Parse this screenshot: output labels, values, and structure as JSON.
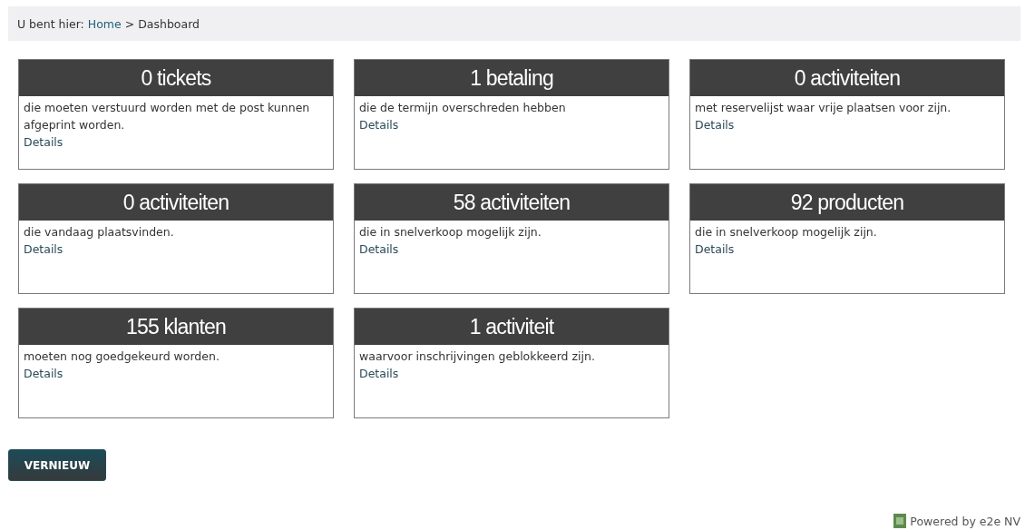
{
  "breadcrumb": {
    "prefix": "U bent hier:",
    "items": [
      {
        "label": "Home",
        "link": true
      },
      {
        "label": "Dashboard",
        "link": false
      }
    ],
    "separator": ">"
  },
  "cards": [
    {
      "title": "0 tickets",
      "text": "die moeten verstuurd worden met de post kunnen afgeprint worden.",
      "link": "Details"
    },
    {
      "title": "1 betaling",
      "text": "die de termijn overschreden hebben",
      "link": "Details"
    },
    {
      "title": "0 activiteiten",
      "text": "met reservelijst waar vrije plaatsen voor zijn.",
      "link": "Details"
    },
    {
      "title": "0 activiteiten",
      "text": "die vandaag plaatsvinden.",
      "link": "Details"
    },
    {
      "title": "58 activiteiten",
      "text": "die in snelverkoop mogelijk zijn.",
      "link": "Details"
    },
    {
      "title": "92 producten",
      "text": "die in snelverkoop mogelijk zijn.",
      "link": "Details"
    },
    {
      "title": "155 klanten",
      "text": "moeten nog goedgekeurd worden.",
      "link": "Details"
    },
    {
      "title": "1 activiteit",
      "text": "waarvoor inschrijvingen geblokkeerd zijn.",
      "link": "Details"
    }
  ],
  "refresh_button": "VERNIEUW",
  "footer": "Powered by e2e NV"
}
